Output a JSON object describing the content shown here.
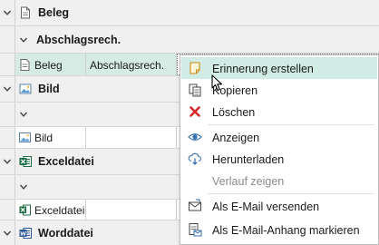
{
  "groups": [
    {
      "title": "Beleg"
    },
    {
      "title": "Bild"
    },
    {
      "title": "Exceldatei"
    },
    {
      "title": "Worddatei"
    }
  ],
  "subgroup": {
    "title": "Abschlagsrech."
  },
  "rows": {
    "beleg": {
      "col1": "Beleg",
      "col2": "Abschlagsrech."
    },
    "bild": {
      "col1": "Bild"
    },
    "excel": {
      "col1": "Exceldatei"
    }
  },
  "menu": {
    "items": [
      {
        "label": "Erinnerung erstellen",
        "icon": "sticky-note-icon",
        "highlighted": true
      },
      {
        "label": "Kopieren",
        "icon": "copy-icon"
      },
      {
        "label": "Löschen",
        "icon": "delete-x-icon"
      },
      {
        "label": "Anzeigen",
        "icon": "eye-icon"
      },
      {
        "label": "Herunterladen",
        "icon": "cloud-download-icon"
      },
      {
        "label": "Verlauf zeigen",
        "icon": "",
        "disabled": true
      },
      {
        "label": "Als E-Mail versenden",
        "icon": "email-icon"
      },
      {
        "label": "Als E-Mail-Anhang markieren",
        "icon": "attachment-mark-icon"
      }
    ]
  },
  "colors": {
    "selection": "#d6ebe3",
    "menu_highlight": "#d1ece4",
    "delete_red": "#d62a2a",
    "excel_green": "#1d7044",
    "word_blue": "#2b5797"
  }
}
